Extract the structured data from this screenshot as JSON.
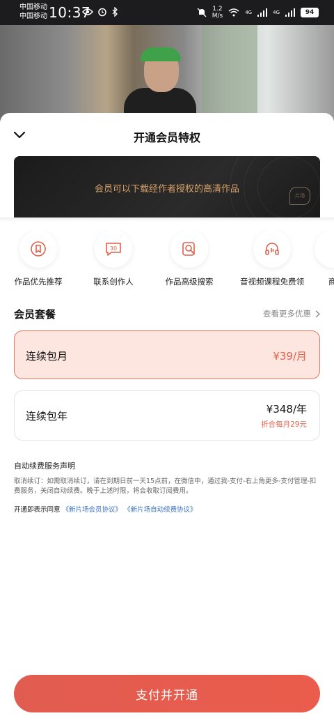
{
  "status_bar": {
    "carrier1": "中国移动",
    "carrier2": "中国移动",
    "time": "10:37",
    "net_speed_value": "1.2",
    "net_speed_unit": "M/s",
    "signal1": "4G",
    "signal2": "4G",
    "battery": "94"
  },
  "sheet": {
    "title": "开通会员特权",
    "banner_text": "会员可以下载经作者授权的高清作品",
    "banner_logo": "片场"
  },
  "features": [
    {
      "label": "作品优先推荐",
      "icon": "bookmark-icon"
    },
    {
      "label": "联系创作人",
      "icon": "chat-30-icon"
    },
    {
      "label": "作品高级搜索",
      "icon": "search-doc-icon"
    },
    {
      "label": "音视频课程免费领",
      "icon": "headphones-icon"
    },
    {
      "label": "商",
      "icon": "more-icon"
    }
  ],
  "plans_section": {
    "title": "会员套餐",
    "more_label": "查看更多优惠"
  },
  "plans": [
    {
      "name": "连续包月",
      "price": "¥39/月",
      "sub": "",
      "selected": true
    },
    {
      "name": "连续包年",
      "price": "¥348/年",
      "sub": "折合每月29元",
      "selected": false
    }
  ],
  "terms": {
    "title": "自动续费服务声明",
    "body": "取消续订：如需取消续订，请在到期日前一天15点前，在微信中，通过我-支付-右上角更多-支付管理-扣费服务，关闭自动续费。晚于上述时限，将会收取订阅费用。",
    "agree_prefix": "开通即表示同意",
    "agreement1": "《新片场会员协议》",
    "agreement2": "《新片场自动续费协议》"
  },
  "pay_button": "支付并开通",
  "colors": {
    "accent": "#e0604a",
    "selected_bg": "#fce6df",
    "link": "#3b73c5",
    "banner_text": "#d9a26a"
  }
}
